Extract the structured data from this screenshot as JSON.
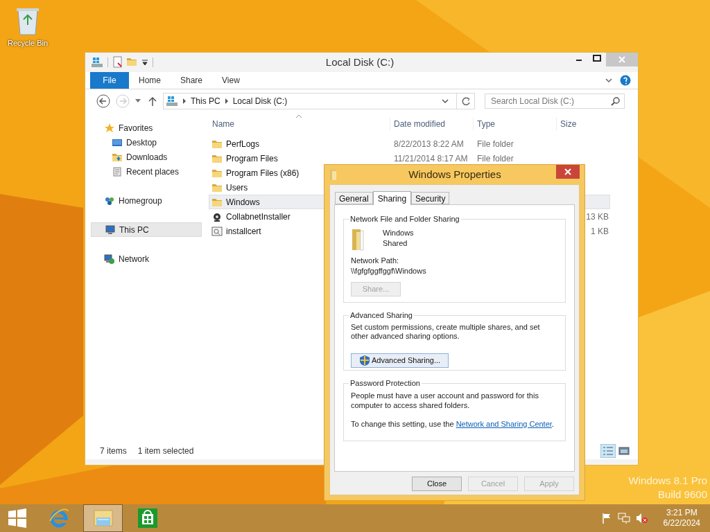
{
  "desktop": {
    "icons": [
      {
        "label": "Recycle Bin"
      }
    ],
    "watermark": [
      "Windows 8.1 Pro",
      "Build 9600"
    ]
  },
  "explorer": {
    "title": "Local Disk (C:)",
    "file_tab": "File",
    "ribbon_tabs": [
      "Home",
      "Share",
      "View"
    ],
    "breadcrumb": [
      "This PC",
      "Local Disk (C:)"
    ],
    "search": {
      "placeholder": "Search Local Disk (C:)"
    },
    "navigation": [
      {
        "label": "Favorites",
        "kind": "favorites",
        "selected": false,
        "children": [
          {
            "label": "Desktop",
            "kind": "desktop",
            "selected": false
          },
          {
            "label": "Downloads",
            "kind": "downloads",
            "selected": false
          },
          {
            "label": "Recent places",
            "kind": "recent",
            "selected": false
          }
        ]
      },
      {
        "label": "Homegroup",
        "kind": "homegroup",
        "selected": false
      },
      {
        "label": "This PC",
        "kind": "pc",
        "selected": true
      },
      {
        "label": "Network",
        "kind": "network",
        "selected": false
      }
    ],
    "columns": [
      "Name",
      "Date modified",
      "Type",
      "Size"
    ],
    "rows": [
      {
        "name": "PerfLogs",
        "kind": "folder",
        "date": "8/22/2013 8:22 AM",
        "type": "File folder",
        "selected": false
      },
      {
        "name": "Program Files",
        "kind": "folder",
        "date": "11/21/2014 8:17 AM",
        "type": "File folder",
        "selected": false
      },
      {
        "name": "Program Files (x86)",
        "kind": "folder",
        "selected": false
      },
      {
        "name": "Users",
        "kind": "folder",
        "selected": false
      },
      {
        "name": "Windows",
        "kind": "folder",
        "selected": true
      },
      {
        "name": "CollabnetInstaller",
        "kind": "program",
        "size": "13 KB",
        "selected": false
      },
      {
        "name": "installcert",
        "kind": "script",
        "size": "1 KB",
        "selected": false
      }
    ],
    "status": [
      "7 items",
      "1 item selected"
    ]
  },
  "dialog": {
    "title": "Windows Properties",
    "tabs": [
      {
        "label": "General",
        "selected": false
      },
      {
        "label": "Sharing",
        "selected": true
      },
      {
        "label": "Security",
        "selected": false
      }
    ],
    "sharing": {
      "heading": "Network File and Folder Sharing",
      "name": "Windows",
      "state": "Shared",
      "path_label": "Network Path:",
      "path": "\\\\fgfgfggffggf\\Windows",
      "button": {
        "label": "Share...",
        "disabled": true
      }
    },
    "advanced": {
      "heading": "Advanced Sharing",
      "text": "Set custom permissions, create multiple shares, and set other advanced sharing options.",
      "button": {
        "label": "Advanced Sharing...",
        "disabled": false
      }
    },
    "password": {
      "heading": "Password Protection",
      "text": "People must have a user account and password for this computer to access shared folders.",
      "change_text": "To change this setting, use the ",
      "link": "Network and Sharing Center",
      "after_link": "."
    },
    "buttons": [
      {
        "label": "Close",
        "disabled": false
      },
      {
        "label": "Cancel",
        "disabled": true
      },
      {
        "label": "Apply",
        "disabled": true
      }
    ]
  },
  "taskbar": {
    "apps": [
      {
        "kind": "browser",
        "active": false
      },
      {
        "kind": "explorer",
        "active": true
      },
      {
        "kind": "store",
        "active": false
      }
    ],
    "clock": {
      "time": "3:21 PM",
      "date": "6/22/2024"
    }
  }
}
